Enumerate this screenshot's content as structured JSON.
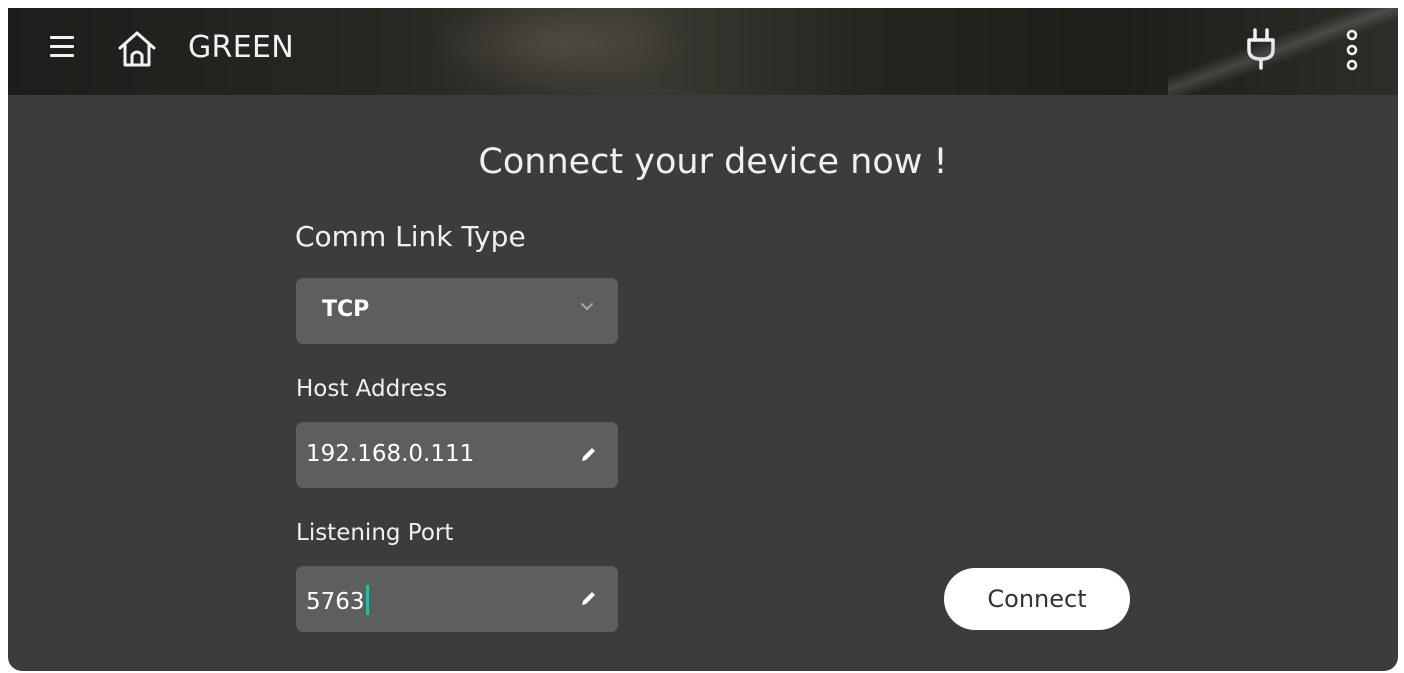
{
  "header": {
    "title": "GREEN",
    "icons": {
      "menu": "hamburger-icon",
      "home": "home-icon",
      "plug": "plug-icon",
      "more": "more-vertical-icon"
    }
  },
  "main": {
    "heading": "Connect your device now !",
    "comm_link": {
      "label": "Comm Link Type",
      "selected": "TCP"
    },
    "host": {
      "label": "Host Address",
      "value": "192.168.0.111"
    },
    "port": {
      "label": "Listening Port",
      "value": "5763"
    },
    "connect_label": "Connect"
  },
  "colors": {
    "panel_background": "#3c3c3c",
    "field_background": "#5e5e5e",
    "text": "#f0f0f0",
    "cursor": "#1fc0a9",
    "button_background": "#ffffff"
  }
}
